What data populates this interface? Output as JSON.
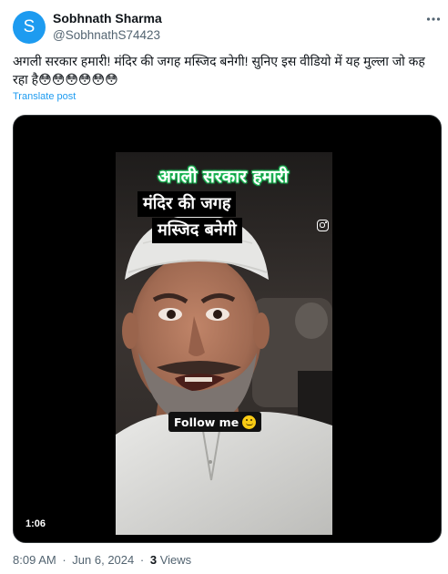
{
  "author": {
    "avatar_letter": "S",
    "display_name": "Sobhnath Sharma",
    "handle": "@SobhnathS74423",
    "avatar_color": "#1d9bf0"
  },
  "tweet": {
    "text": "अगली सरकार हमारी! मंदिर की जगह मस्जिद बनेगी! सुनिए इस वीडियो में यह मुल्ला  जो कह रहा है",
    "emojis": "😳😳😳😳😳😳",
    "translate_label": "Translate post"
  },
  "video": {
    "caption_line_1": "अगली सरकार हमारी",
    "caption_line_2": "मंदिर की जगह",
    "caption_line_3": "मस्जिद बनेगी",
    "follow_label": "Follow me",
    "duration": "1:06",
    "icons": {
      "social": "instagram-icon",
      "emoji": "smiley-icon"
    }
  },
  "meta": {
    "time": "8:09 AM",
    "separator": "·",
    "date": "Jun 6, 2024",
    "views_count": "3",
    "views_label": "Views"
  },
  "icons": {
    "more": "more-options-icon"
  },
  "colors": {
    "accent": "#1d9bf0",
    "text_primary": "#0f1419",
    "text_secondary": "#536471",
    "caption_glow": "#22c55e"
  }
}
